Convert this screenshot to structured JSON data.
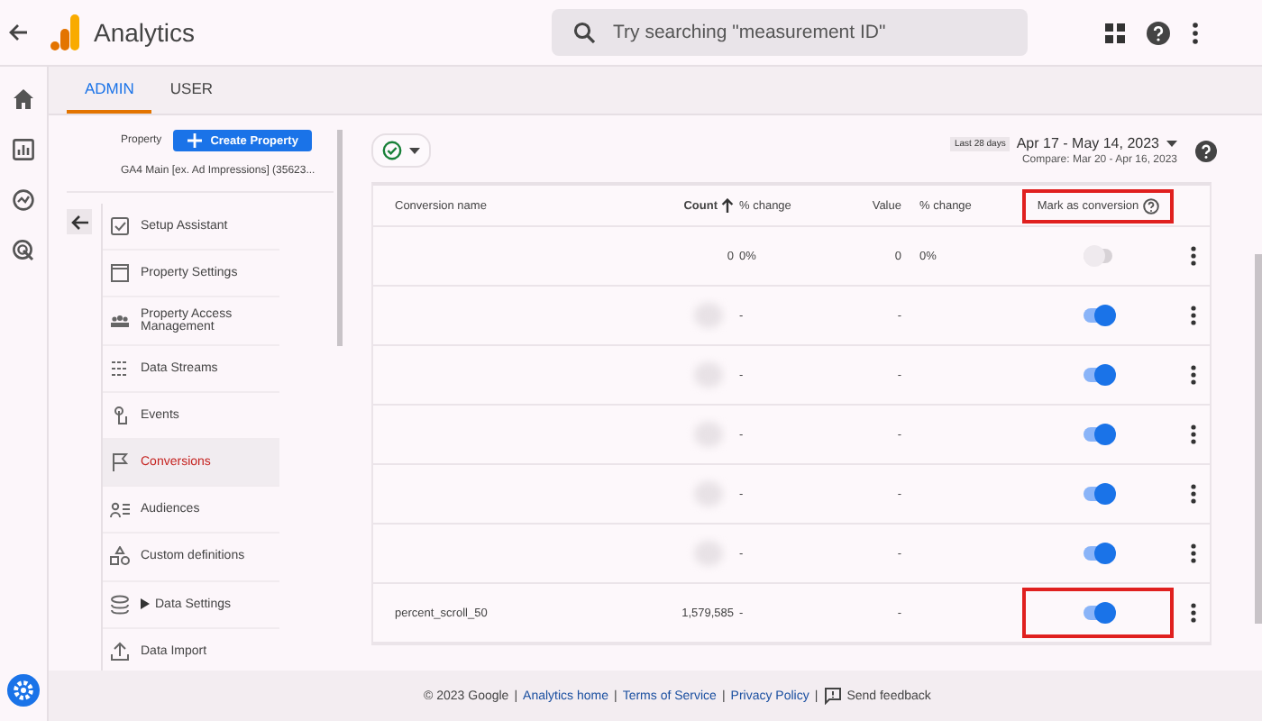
{
  "app": {
    "title": "Analytics"
  },
  "search": {
    "placeholder": "Try searching \"measurement ID\""
  },
  "tabs": [
    {
      "label": "ADMIN",
      "selected": true
    },
    {
      "label": "USER",
      "selected": false
    }
  ],
  "property": {
    "label": "Property",
    "create_button": "Create Property",
    "current": "GA4 Main [ex. Ad Impressions] (35623..."
  },
  "nav_items": [
    {
      "label": "Setup Assistant",
      "selected": false,
      "expandable": false
    },
    {
      "label": "Property Settings",
      "selected": false,
      "expandable": false
    },
    {
      "label": "Property Access Management",
      "selected": false,
      "expandable": false
    },
    {
      "label": "Data Streams",
      "selected": false,
      "expandable": false
    },
    {
      "label": "Events",
      "selected": false,
      "expandable": false
    },
    {
      "label": "Conversions",
      "selected": true,
      "expandable": false
    },
    {
      "label": "Audiences",
      "selected": false,
      "expandable": false
    },
    {
      "label": "Custom definitions",
      "selected": false,
      "expandable": false
    },
    {
      "label": "Data Settings",
      "selected": false,
      "expandable": true
    },
    {
      "label": "Data Import",
      "selected": false,
      "expandable": false
    }
  ],
  "date_range": {
    "preset": "Last 28 days",
    "range": "Apr 17 - May 14, 2023",
    "compare": "Compare: Mar 20 - Apr 16, 2023"
  },
  "table": {
    "columns": [
      "Conversion name",
      "Count",
      "% change",
      "Value",
      "% change",
      "Mark as conversion"
    ],
    "sorted_by_count": true,
    "mark_header_highlighted": true,
    "rows": [
      {
        "name": "",
        "count": "0",
        "count_change": "0%",
        "value": "0",
        "value_change": "0%",
        "redacted": false,
        "on": false,
        "highlighted": false
      },
      {
        "name": "",
        "count": "",
        "count_change": "-",
        "value": "-",
        "value_change": "",
        "redacted": true,
        "on": true,
        "highlighted": false
      },
      {
        "name": "",
        "count": "",
        "count_change": "-",
        "value": "-",
        "value_change": "",
        "redacted": true,
        "on": true,
        "highlighted": false
      },
      {
        "name": "",
        "count": "",
        "count_change": "-",
        "value": "-",
        "value_change": "",
        "redacted": true,
        "on": true,
        "highlighted": false
      },
      {
        "name": "",
        "count": "",
        "count_change": "-",
        "value": "-",
        "value_change": "",
        "redacted": true,
        "on": true,
        "highlighted": false
      },
      {
        "name": "",
        "count": "",
        "count_change": "-",
        "value": "-",
        "value_change": "",
        "redacted": true,
        "on": true,
        "highlighted": false
      },
      {
        "name": "percent_scroll_50",
        "count": "1,579,585",
        "count_change": "-",
        "value": "-",
        "value_change": "",
        "redacted": false,
        "on": true,
        "highlighted": true
      }
    ]
  },
  "footer": {
    "copyright": "© 2023 Google",
    "separator": "|",
    "links": [
      "Analytics home",
      "Terms of Service",
      "Privacy Policy"
    ],
    "feedback": "Send feedback"
  }
}
